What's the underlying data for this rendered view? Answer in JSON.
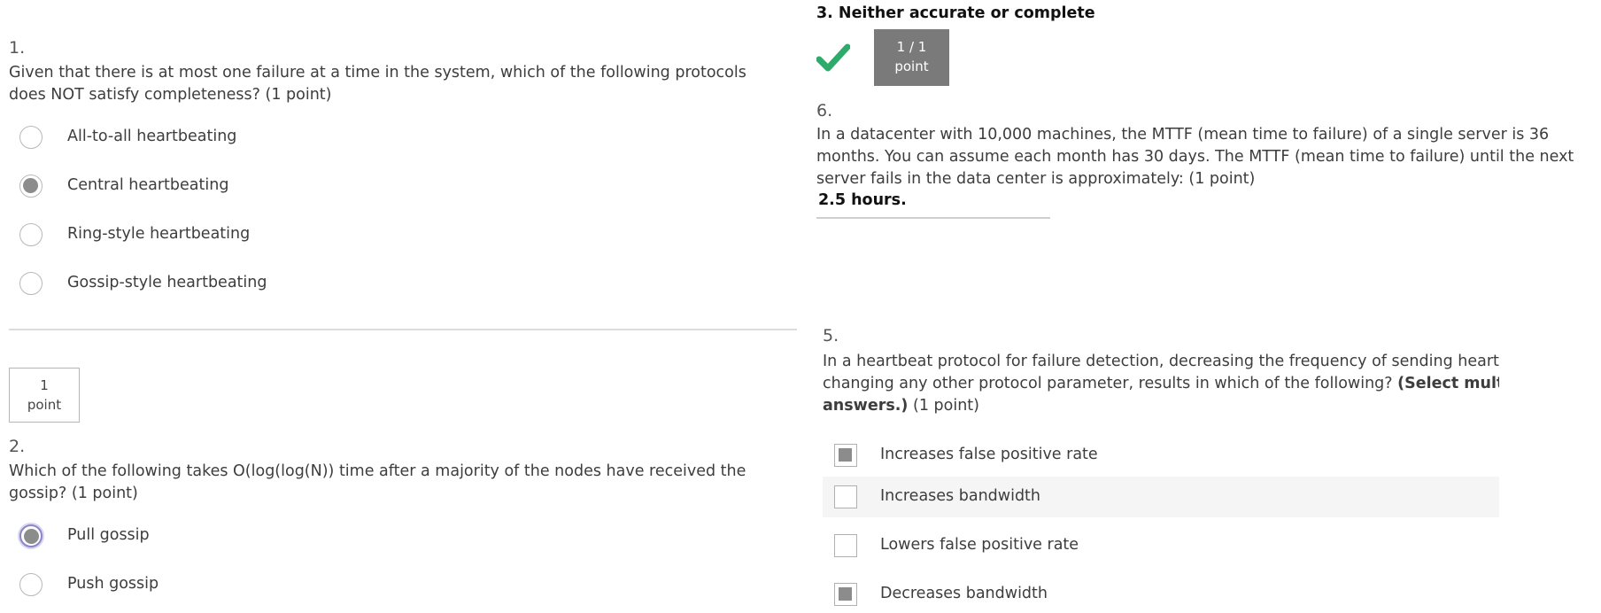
{
  "q1": {
    "number": "1.",
    "text": "Given that there is at most one failure at a time in the system, which of the following protocols does NOT satisfy completeness? (1 point)",
    "options": [
      {
        "label": "All-to-all heartbeating",
        "selected": false
      },
      {
        "label": "Central heartbeating",
        "selected": true
      },
      {
        "label": "Ring-style heartbeating",
        "selected": false
      },
      {
        "label": "Gossip-style heartbeating",
        "selected": false
      }
    ]
  },
  "q2": {
    "points_value": "1",
    "points_unit": "point",
    "number": "2.",
    "text": "Which of the following takes O(log(log(N)) time after a majority of the nodes have received the gossip? (1 point)",
    "options": [
      {
        "label": "Pull gossip",
        "selected": true
      },
      {
        "label": "Push gossip",
        "selected": false
      }
    ]
  },
  "q3_answer": "3. Neither accurate or complete",
  "score_badge": {
    "value": "1 / 1",
    "unit": "point",
    "status": "correct",
    "color": "#2eaa6b",
    "bg": "#7a7a7a"
  },
  "q6": {
    "number": "6.",
    "text": "In a datacenter with 10,000 machines, the MTTF (mean time to failure) of a single server is 36 months. You can assume each month has 30 days. The MTTF (mean time to failure) until the next server fails in the data center is approximately: (1 point)",
    "answer": "2.5 hours."
  },
  "q5": {
    "number": "5.",
    "text_line1": "In a heartbeat protocol for failure detection, decreasing the frequency of sending heartbeats, w",
    "text_line2_plain": "changing any other protocol parameter, results in which of the following?",
    "text_line2_bold": "(Select multiple co",
    "text_line3_bold": "answers.)",
    "text_line3_plain": "(1 point)",
    "options": [
      {
        "label": "Increases false positive rate",
        "checked": true
      },
      {
        "label": "Increases bandwidth",
        "checked": false
      },
      {
        "label": "Lowers false positive rate",
        "checked": false
      },
      {
        "label": "Decreases bandwidth",
        "checked": true
      }
    ]
  }
}
